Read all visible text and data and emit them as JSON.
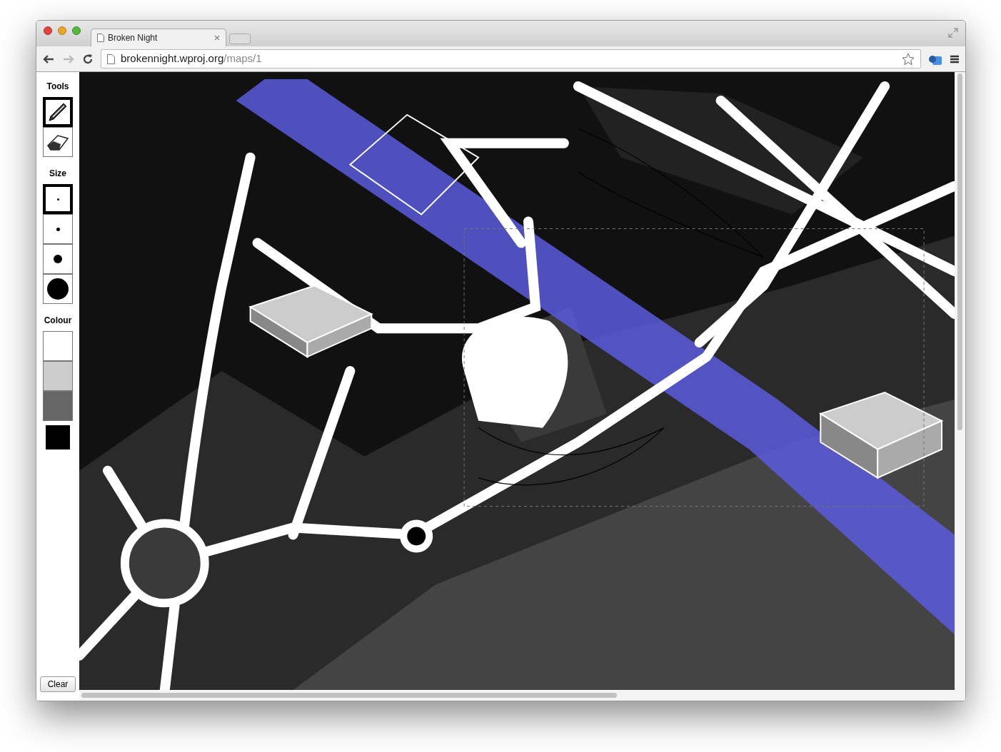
{
  "window": {
    "tab": {
      "title": "Broken Night"
    },
    "address": {
      "host": "brokennight.wproj.org",
      "path": "/maps/1"
    }
  },
  "sidebar": {
    "tools_label": "Tools",
    "tools": [
      {
        "kind": "pencil",
        "selected": true
      },
      {
        "kind": "eraser",
        "selected": false
      }
    ],
    "size_label": "Size",
    "sizes": [
      {
        "kind": "tiny",
        "selected": true
      },
      {
        "kind": "small",
        "selected": false
      },
      {
        "kind": "medium",
        "selected": false
      },
      {
        "kind": "large",
        "selected": false
      }
    ],
    "colour_label": "Colour",
    "colours": [
      {
        "color": "#ffffff",
        "selected": false
      },
      {
        "color": "#cccccc",
        "selected": false
      },
      {
        "color": "#666666",
        "selected": false
      },
      {
        "color": "#000000",
        "selected": true
      }
    ],
    "clear_button": "Clear"
  }
}
